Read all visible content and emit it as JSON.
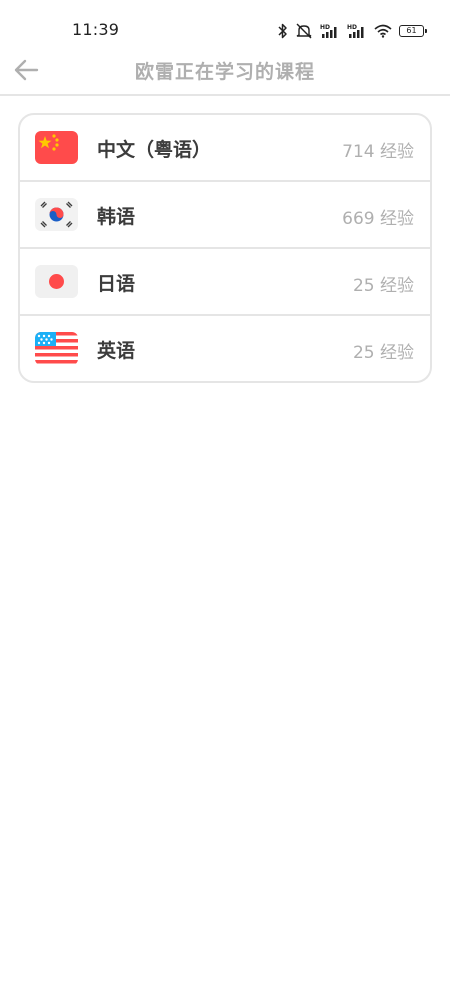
{
  "status_bar": {
    "time": "11:39",
    "battery_level": "61",
    "icons": [
      "bluetooth-icon",
      "mute-icon",
      "hd-signal-icon",
      "hd-signal-icon",
      "wifi-icon",
      "battery-icon"
    ]
  },
  "header": {
    "title": "欧雷正在学习的课程",
    "back_icon": "arrow-left-icon"
  },
  "courses": [
    {
      "name": "中文（粤语）",
      "xp": "714 经验",
      "flag": "china-flag-icon"
    },
    {
      "name": "韩语",
      "xp": "669 经验",
      "flag": "korea-flag-icon"
    },
    {
      "name": "日语",
      "xp": "25 经验",
      "flag": "japan-flag-icon"
    },
    {
      "name": "英语",
      "xp": "25 经验",
      "flag": "usa-flag-icon"
    }
  ],
  "colors": {
    "title_gray": "#afafaf",
    "text_dark": "#3c3c3c",
    "border": "#e5e5e5",
    "flag_red": "#ff4b4b",
    "flag_blue": "#1cb0f6"
  }
}
